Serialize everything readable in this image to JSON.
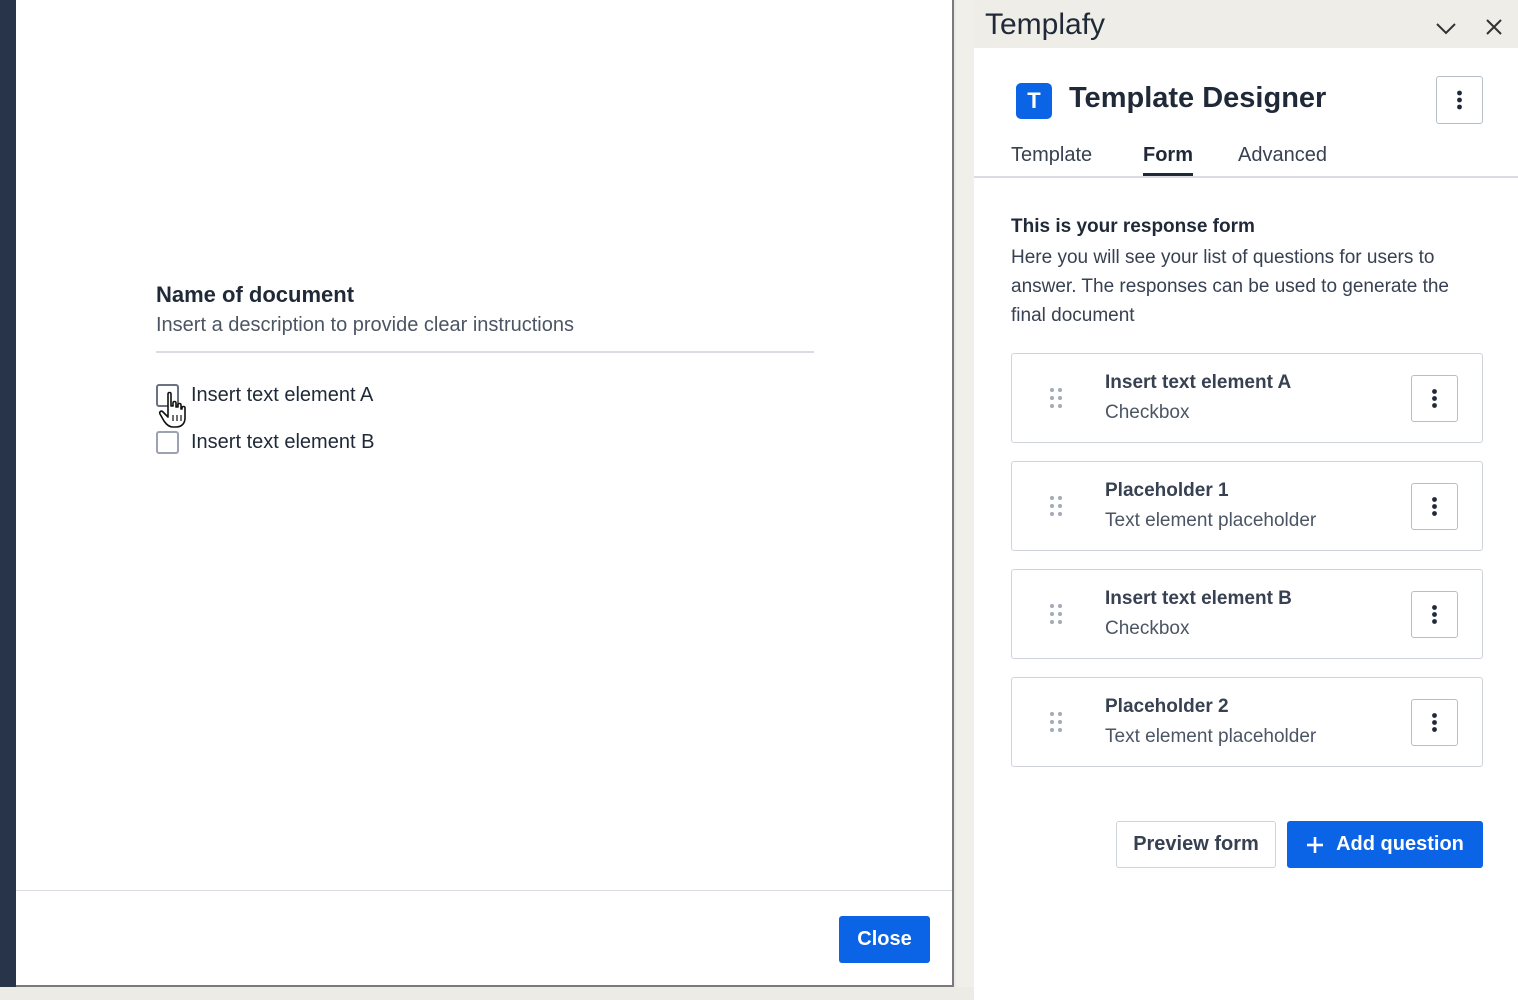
{
  "preview": {
    "doc_title": "Name of document",
    "doc_description": "Insert a description to provide clear instructions",
    "checkboxes": [
      {
        "label": "Insert text element A",
        "checked": false
      },
      {
        "label": "Insert text element B",
        "checked": false
      }
    ],
    "close_label": "Close"
  },
  "panel": {
    "window_title": "Templafy",
    "logo_letter": "T",
    "app_name": "Template Designer",
    "tabs": [
      {
        "label": "Template",
        "active": false
      },
      {
        "label": "Form",
        "active": true
      },
      {
        "label": "Advanced",
        "active": false
      }
    ],
    "form_heading": "This is your response form",
    "form_description": "Here you will see your list of questions for users to answer. The responses can be used to generate the final document",
    "questions": [
      {
        "title": "Insert text element A",
        "type": "Checkbox"
      },
      {
        "title": "Placeholder 1",
        "type": "Text element placeholder"
      },
      {
        "title": "Insert text element B",
        "type": "Checkbox"
      },
      {
        "title": "Placeholder 2",
        "type": "Text element placeholder"
      }
    ],
    "preview_form_label": "Preview form",
    "add_question_label": "Add question"
  },
  "icons": {
    "chevron": "chevron-down-icon",
    "close": "close-icon",
    "kebab": "more-vertical-icon",
    "drag": "drag-handle-icon",
    "plus": "plus-icon",
    "cursor": "hand-pointer-icon"
  },
  "colors": {
    "accent": "#0b63e5",
    "sidebar_dark": "#28344a",
    "titlebar": "#eeede8"
  }
}
